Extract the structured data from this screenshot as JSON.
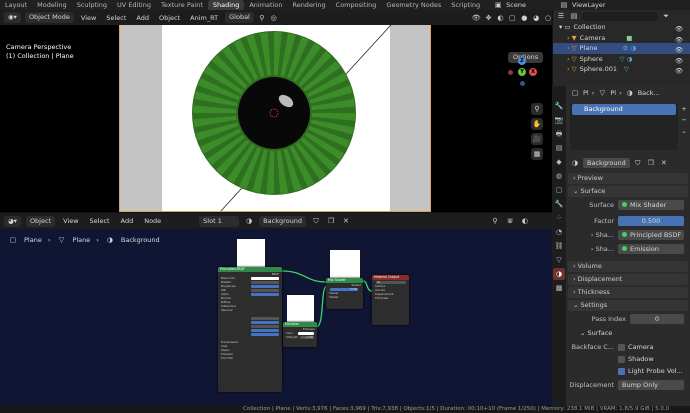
{
  "top_tabs": [
    "Layout",
    "Modeling",
    "Sculpting",
    "UV Editing",
    "Texture Paint",
    "Shading",
    "Animation",
    "Rendering",
    "Compositing",
    "Geometry Nodes",
    "Scripting"
  ],
  "active_tab": "Shading",
  "scene": "Scene",
  "view_layer": "ViewLayer",
  "viewport": {
    "mode": "Object Mode",
    "menus": [
      "View",
      "Select",
      "Add",
      "Object"
    ],
    "extra_menu": "Anim_RT",
    "transform": "Global",
    "info_line1": "Camera Perspective",
    "info_line2": "(1) Collection | Plane",
    "options_label": "Options",
    "gizmo": {
      "x": "X",
      "y": "Y",
      "z": "Z"
    }
  },
  "node_editor": {
    "type": "Object",
    "menus": [
      "View",
      "Select",
      "Add",
      "Node"
    ],
    "slot": "Slot 1",
    "material": "Background",
    "breadcrumb": [
      "Plane",
      "Plane",
      "Background"
    ],
    "nodes": {
      "bsdf_title": "Principled BSDF",
      "bsdf_rows": [
        "Base Color",
        "Metallic",
        "Roughness",
        "IOR",
        "Alpha",
        "Normal",
        "Diffuse",
        "Subsurface",
        "Specular",
        "Transmission",
        "Coat",
        "Sheen",
        "Emission",
        "Thin Film"
      ],
      "emission_title": "Emission",
      "emission_rows": [
        "Color",
        "Strength"
      ],
      "mix_title": "Mix Shader",
      "mix_rows": [
        "Shader",
        "Fac",
        "Shader",
        "Shader"
      ],
      "output_title": "Material Output",
      "output_rows": [
        "All",
        "Surface",
        "Volume",
        "Displacement",
        "Thickness"
      ],
      "strength_value": "1.000",
      "fac_value": "0.500"
    }
  },
  "outliner": {
    "items": [
      {
        "name": "Collection",
        "level": 0,
        "selected": false
      },
      {
        "name": "Camera",
        "level": 1,
        "selected": false
      },
      {
        "name": "Plane",
        "level": 1,
        "selected": true
      },
      {
        "name": "Sphere",
        "level": 1,
        "selected": false
      },
      {
        "name": "Sphere.001",
        "level": 1,
        "selected": false
      }
    ]
  },
  "properties": {
    "breadcrumb": [
      "Pl",
      "Pl",
      "Back..."
    ],
    "material_slot": "Background",
    "material_name": "Background",
    "sections": {
      "preview": "Preview",
      "surface": "Surface",
      "volume": "Volume",
      "displacement": "Displacement",
      "thickness": "Thickness",
      "settings": "Settings"
    },
    "surface_label": "Surface",
    "surface_value": "Mix Shader",
    "factor_label": "Factor",
    "factor_value": "0.500",
    "shader1_label": "Sha...",
    "shader1_value": "Principled BSDF",
    "shader2_label": "Sha...",
    "shader2_value": "Emission",
    "pass_index_label": "Pass Index",
    "pass_index_value": "0",
    "sub_surface": "Surface",
    "backface_label": "Backface C...",
    "backface_camera": "Camera",
    "backface_shadow": "Shadow",
    "light_probe": "Light Probe Vol...",
    "displacement_label": "Displacement",
    "displacement_value": "Bump Only"
  },
  "status_bar": "Collection | Plane | Verts:3,976 | Faces:3,969 | Tris:7,938 | Objects:1/5 | Duration: 00:10+10 (Frame 1/250) | Memory: 238.1 MiB | VRAM: 1.8/5.9 GiB | 5.0.0",
  "colors": {
    "accent": "#4772b3",
    "green_fan": "#3d8c2a",
    "selection": "#334d80"
  }
}
